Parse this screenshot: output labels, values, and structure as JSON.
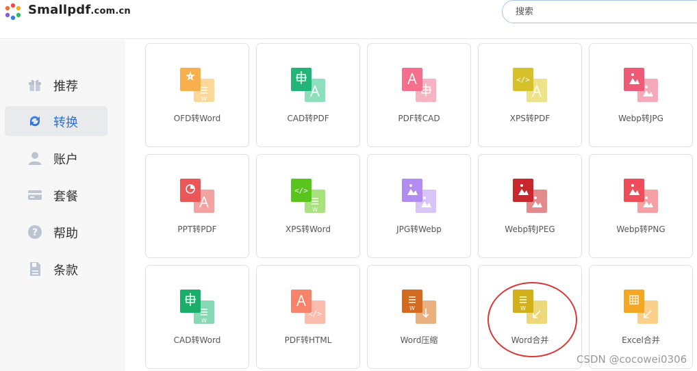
{
  "header": {
    "brand_main": "Smallpdf",
    "brand_suffix": ".com.cn",
    "search_placeholder": "搜索"
  },
  "sidebar": {
    "items": [
      {
        "label": "推荐",
        "icon": "gift-icon",
        "active": false
      },
      {
        "label": "转换",
        "icon": "convert-arrows-icon",
        "active": true
      },
      {
        "label": "账户",
        "icon": "user-icon",
        "active": false
      },
      {
        "label": "套餐",
        "icon": "card-icon",
        "active": false
      },
      {
        "label": "帮助",
        "icon": "help-icon",
        "active": false
      },
      {
        "label": "条款",
        "icon": "document-icon",
        "active": false
      }
    ]
  },
  "tools": [
    {
      "label": "OFD转Word",
      "icon": "ofd-to-word-icon",
      "colors": [
        "#f7b04b",
        "#fcd79a"
      ]
    },
    {
      "label": "CAD转PDF",
      "icon": "cad-to-pdf-icon",
      "colors": [
        "#21b677",
        "#8ee0bd"
      ]
    },
    {
      "label": "PDF转CAD",
      "icon": "pdf-to-cad-icon",
      "colors": [
        "#f46f8c",
        "#f8b3c2"
      ]
    },
    {
      "label": "XPS转PDF",
      "icon": "xps-to-pdf-icon",
      "colors": [
        "#d6c12a",
        "#eee38a"
      ]
    },
    {
      "label": "Webp转JPG",
      "icon": "webp-to-jpg-icon",
      "colors": [
        "#ef5a76",
        "#f6a9b8"
      ]
    },
    {
      "label": "PPT转PDF",
      "icon": "ppt-to-pdf-icon",
      "colors": [
        "#ea5758",
        "#f4a2a2"
      ]
    },
    {
      "label": "XPS转Word",
      "icon": "xps-to-word-icon",
      "colors": [
        "#5ac41f",
        "#a8e27f"
      ]
    },
    {
      "label": "JPG转Webp",
      "icon": "jpg-to-webp-icon",
      "colors": [
        "#b28cf0",
        "#d8c4f8"
      ]
    },
    {
      "label": "Webp转JPEG",
      "icon": "webp-to-jpeg-icon",
      "colors": [
        "#c8282c",
        "#e58a8c"
      ]
    },
    {
      "label": "Webp转PNG",
      "icon": "webp-to-png-icon",
      "colors": [
        "#ee4e59",
        "#f6a0a6"
      ]
    },
    {
      "label": "CAD转Word",
      "icon": "cad-to-word-icon",
      "colors": [
        "#1bae6a",
        "#86d9b2"
      ]
    },
    {
      "label": "PDF转HTML",
      "icon": "pdf-to-html-icon",
      "colors": [
        "#f7836a",
        "#fbbcae"
      ]
    },
    {
      "label": "Word压缩",
      "icon": "word-compress-icon",
      "colors": [
        "#d46a1f",
        "#ebb080"
      ]
    },
    {
      "label": "Word合并",
      "icon": "word-merge-icon",
      "colors": [
        "#d2b01a",
        "#ecd878"
      ]
    },
    {
      "label": "Excel合并",
      "icon": "excel-merge-icon",
      "colors": [
        "#f5a623",
        "#fad08a"
      ]
    }
  ],
  "watermark": "CSDN @cocowei0306"
}
